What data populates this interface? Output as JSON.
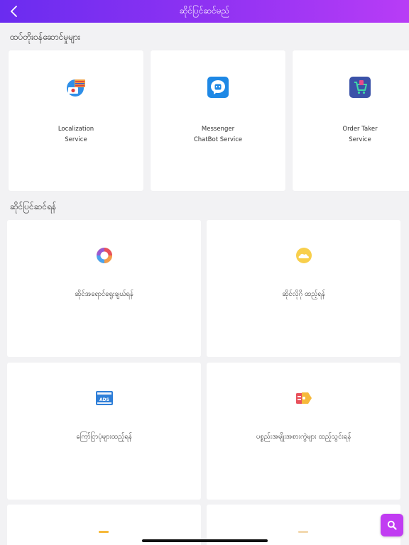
{
  "header": {
    "title": "ဆိုင်ပြင်ဆင်မည်"
  },
  "sections": {
    "services_title": "ထပ်တိုးဝန်ဆောင်မှုများ",
    "shop_setup_title": "ဆိုင်ပြင်ဆင်ရန်"
  },
  "services": [
    {
      "line1": "Localization",
      "line2": "Service",
      "icon": "localization-icon"
    },
    {
      "line1": "Messenger",
      "line2": "ChatBot Service",
      "icon": "chatbot-icon"
    },
    {
      "line1": "Order Taker",
      "line2": "Service",
      "icon": "order-taker-icon"
    }
  ],
  "setup_items": [
    {
      "label": "ဆိုင်အရောင်ရွေးချယ်ရန်",
      "icon": "color-palette-icon"
    },
    {
      "label": "ဆိုင်လိုဂို ထည့်ရန်",
      "icon": "cloud-logo-icon"
    },
    {
      "label": "ကြော်ငြာပုံများထည့်ရန်",
      "icon": "ads-banner-icon"
    },
    {
      "label": "ပစ္စည်းအမျိုးအစားကွဲများ ထည့်သွင်းရန်",
      "icon": "category-tag-icon"
    }
  ],
  "colors": {
    "header_start": "#6a2cf0",
    "header_end": "#b83cf6",
    "fab": "#c13cf2"
  }
}
